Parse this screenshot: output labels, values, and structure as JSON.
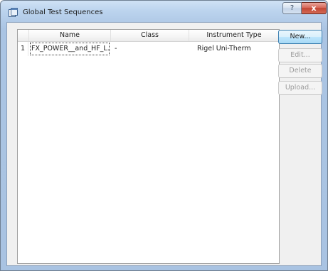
{
  "window": {
    "title": "Global Test Sequences",
    "help_label": "?",
    "close_label": "x"
  },
  "table": {
    "columns": [
      "Name",
      "Class",
      "Instrument Type"
    ],
    "rows": [
      {
        "num": "1",
        "name": "FX_POWER__and_HF_L...",
        "class": "-",
        "instrument_type": "Rigel Uni-Therm"
      }
    ]
  },
  "buttons": {
    "new": "New...",
    "edit": "Edit...",
    "delete": "Delete",
    "upload": "Upload..."
  },
  "colors": {
    "titlebar": "#b2cbe8",
    "close_button": "#c24634",
    "primary_button_border": "#3c7fb1"
  }
}
